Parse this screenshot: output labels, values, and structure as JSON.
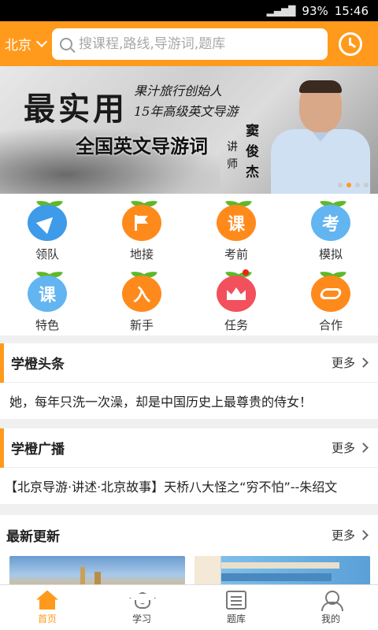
{
  "statusbar": {
    "battery": "93%",
    "time": "15:46"
  },
  "header": {
    "city": "北京",
    "search_placeholder": "搜课程,路线,导游词,题库"
  },
  "banner": {
    "headline": "最实用",
    "line1": "果汁旅行创始人",
    "line2": "15年高级英文导游",
    "slogan": "全国英文导游词",
    "role": "讲师",
    "name": "窦俊杰"
  },
  "grid": [
    {
      "label": "领队",
      "icon": "plane-icon",
      "glyph": ""
    },
    {
      "label": "地接",
      "icon": "flag-icon",
      "glyph": ""
    },
    {
      "label": "考前",
      "icon": "course-icon",
      "glyph": "课"
    },
    {
      "label": "模拟",
      "icon": "exam-icon",
      "glyph": "考"
    },
    {
      "label": "特色",
      "icon": "feature-course-icon",
      "glyph": "课"
    },
    {
      "label": "新手",
      "icon": "beginner-icon",
      "glyph": "入"
    },
    {
      "label": "任务",
      "icon": "crown-icon",
      "glyph": ""
    },
    {
      "label": "合作",
      "icon": "handshake-icon",
      "glyph": ""
    }
  ],
  "headlines": {
    "title": "学橙头条",
    "more": "更多",
    "item": "她，每年只洗一次澡，却是中国历史上最尊贵的侍女！"
  },
  "broadcast": {
    "title": "学橙广播",
    "more": "更多",
    "item": "【北京导游·讲述·北京故事】天桥八大怪之“穷不怕”--朱绍文"
  },
  "updates": {
    "title": "最新更新",
    "more": "更多"
  },
  "tabbar": [
    {
      "label": "首页",
      "icon": "home-icon"
    },
    {
      "label": "学习",
      "icon": "graduation-cap-icon"
    },
    {
      "label": "题库",
      "icon": "question-bank-icon"
    },
    {
      "label": "我的",
      "icon": "profile-icon"
    }
  ],
  "colors": {
    "accent": "#ff9a1c",
    "blue": "#3e9be9",
    "red": "#f2505c"
  }
}
